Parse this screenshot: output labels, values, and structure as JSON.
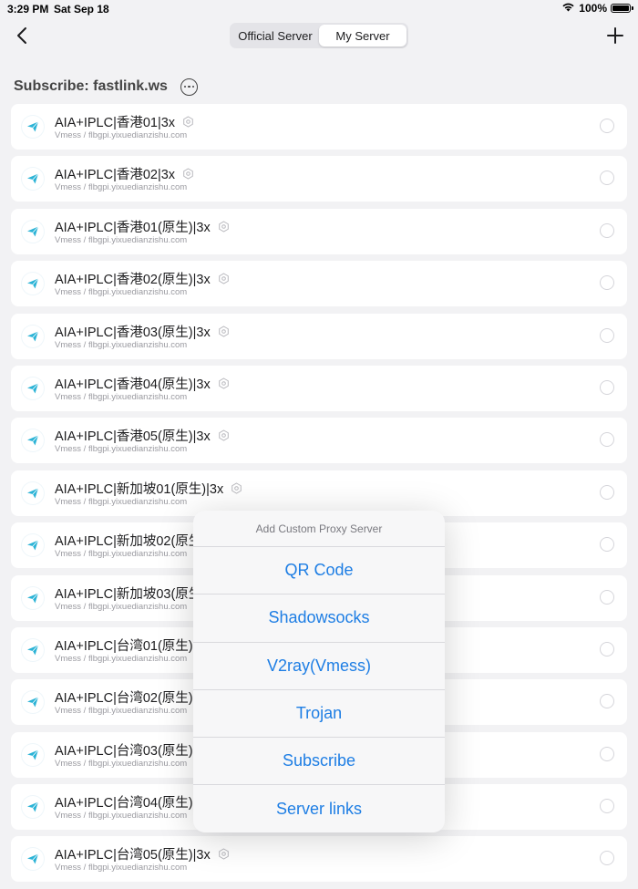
{
  "status_bar": {
    "time": "3:29 PM",
    "date": "Sat Sep 18",
    "battery": "100%"
  },
  "nav": {
    "tabs": [
      {
        "label": "Official Server",
        "active": false
      },
      {
        "label": "My Server",
        "active": true
      }
    ],
    "back_icon": "chevron-left-icon",
    "add_icon": "plus-icon"
  },
  "section": {
    "title": "Subscribe: fastlink.ws",
    "more_icon": "ellipsis-circle-icon"
  },
  "servers": [
    {
      "name": "AIA+IPLC|香港01|3x",
      "detail": "Vmess / flbgpi.yixuedianzishu.com"
    },
    {
      "name": "AIA+IPLC|香港02|3x",
      "detail": "Vmess / flbgpi.yixuedianzishu.com"
    },
    {
      "name": "AIA+IPLC|香港01(原生)|3x",
      "detail": "Vmess / flbgpi.yixuedianzishu.com"
    },
    {
      "name": "AIA+IPLC|香港02(原生)|3x",
      "detail": "Vmess / flbgpi.yixuedianzishu.com"
    },
    {
      "name": "AIA+IPLC|香港03(原生)|3x",
      "detail": "Vmess / flbgpi.yixuedianzishu.com"
    },
    {
      "name": "AIA+IPLC|香港04(原生)|3x",
      "detail": "Vmess / flbgpi.yixuedianzishu.com"
    },
    {
      "name": "AIA+IPLC|香港05(原生)|3x",
      "detail": "Vmess / flbgpi.yixuedianzishu.com"
    },
    {
      "name": "AIA+IPLC|新加坡01(原生)|3x",
      "detail": "Vmess / flbgpi.yixuedianzishu.com"
    },
    {
      "name": "AIA+IPLC|新加坡02(原生)|3x",
      "detail": "Vmess / flbgpi.yixuedianzishu.com"
    },
    {
      "name": "AIA+IPLC|新加坡03(原生)|3x",
      "detail": "Vmess / flbgpi.yixuedianzishu.com"
    },
    {
      "name": "AIA+IPLC|台湾01(原生)|3x",
      "detail": "Vmess / flbgpi.yixuedianzishu.com"
    },
    {
      "name": "AIA+IPLC|台湾02(原生)|3x",
      "detail": "Vmess / flbgpi.yixuedianzishu.com"
    },
    {
      "name": "AIA+IPLC|台湾03(原生)|3x",
      "detail": "Vmess / flbgpi.yixuedianzishu.com"
    },
    {
      "name": "AIA+IPLC|台湾04(原生)|3x",
      "detail": "Vmess / flbgpi.yixuedianzishu.com"
    },
    {
      "name": "AIA+IPLC|台湾05(原生)|3x",
      "detail": "Vmess / flbgpi.yixuedianzishu.com"
    }
  ],
  "popover": {
    "title": "Add Custom Proxy Server",
    "items": [
      "QR Code",
      "Shadowsocks",
      "V2ray(Vmess)",
      "Trojan",
      "Subscribe",
      "Server links"
    ]
  },
  "colors": {
    "accent": "#1e7ee4",
    "icon": "#2bb3d6",
    "background": "#f2f2f4"
  }
}
